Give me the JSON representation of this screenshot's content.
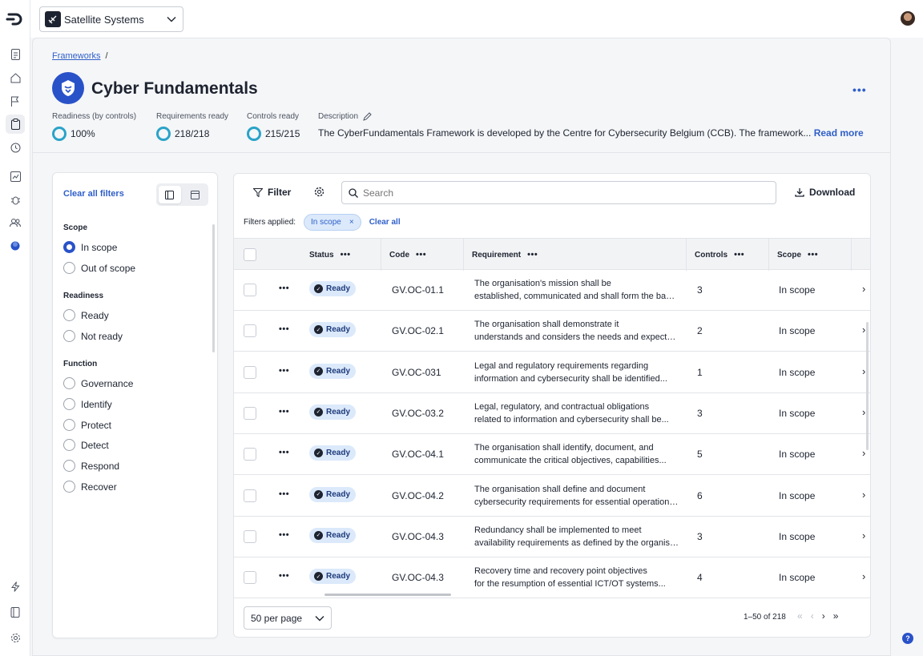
{
  "org": {
    "name": "Satellite Systems"
  },
  "breadcrumb": {
    "root": "Frameworks",
    "sep": "/"
  },
  "framework": {
    "title": "Cyber Fundamentals",
    "stats": [
      {
        "label": "Readiness (by controls)",
        "value": "100%"
      },
      {
        "label": "Requirements ready",
        "value": "218/218"
      },
      {
        "label": "Controls ready",
        "value": "215/215"
      }
    ],
    "description": {
      "label": "Description",
      "text": "The CyberFundamentals Framework is developed by the Centre for Cybersecurity Belgium (CCB). The framework...",
      "read_more": "Read more"
    }
  },
  "filters": {
    "clear_label": "Clear all filters",
    "sections": [
      {
        "title": "Scope",
        "options": [
          {
            "label": "In scope",
            "selected": true
          },
          {
            "label": "Out of scope",
            "selected": false
          }
        ]
      },
      {
        "title": "Readiness",
        "options": [
          {
            "label": "Ready",
            "selected": false
          },
          {
            "label": "Not ready",
            "selected": false
          }
        ]
      },
      {
        "title": "Function",
        "options": [
          {
            "label": "Governance",
            "selected": false
          },
          {
            "label": "Identify",
            "selected": false
          },
          {
            "label": "Protect",
            "selected": false
          },
          {
            "label": "Detect",
            "selected": false
          },
          {
            "label": "Respond",
            "selected": false
          },
          {
            "label": "Recover",
            "selected": false
          }
        ]
      }
    ]
  },
  "toolbar": {
    "filter_label": "Filter",
    "search_placeholder": "Search",
    "download_label": "Download",
    "applied_label": "Filters applied:",
    "chip_label": "In scope",
    "chip_close": "×",
    "clear_all": "Clear all"
  },
  "table": {
    "headers": {
      "status": "Status",
      "code": "Code",
      "requirement": "Requirement",
      "controls": "Controls",
      "scope": "Scope",
      "menu": "•••"
    },
    "rows": [
      {
        "status": "Ready",
        "code": "GV.OC-01.1",
        "req1": "The organisation's mission shall be",
        "req2": "established, communicated and shall form the basis for...",
        "controls": "3",
        "scope": "In scope"
      },
      {
        "status": "Ready",
        "code": "GV.OC-02.1",
        "req1": "The organisation shall demonstrate it",
        "req2": "understands and considers the needs and expectations...",
        "controls": "2",
        "scope": "In scope"
      },
      {
        "status": "Ready",
        "code": "GV.OC-031",
        "req1": "Legal and regulatory requirements regarding",
        "req2": "information and cybersecurity shall be identified...",
        "controls": "1",
        "scope": "In scope"
      },
      {
        "status": "Ready",
        "code": "GV.OC-03.2",
        "req1": "Legal, regulatory, and contractual obligations",
        "req2": "related to information and cybersecurity shall be...",
        "controls": "3",
        "scope": "In scope"
      },
      {
        "status": "Ready",
        "code": "GV.OC-04.1",
        "req1": "The organisation shall identify, document, and",
        "req2": "communicate the critical objectives, capabilities...",
        "controls": "5",
        "scope": "In scope"
      },
      {
        "status": "Ready",
        "code": "GV.OC-04.2",
        "req1": "The organisation shall define and document",
        "req2": "cybersecurity requirements for essential operations...",
        "controls": "6",
        "scope": "In scope"
      },
      {
        "status": "Ready",
        "code": "GV.OC-04.3",
        "req1": "Redundancy shall be implemented to meet",
        "req2": "availability requirements as defined by the organisation...",
        "controls": "3",
        "scope": "In scope"
      },
      {
        "status": "Ready",
        "code": "GV.OC-04.3",
        "req1": "Recovery time and recovery point objectives",
        "req2": "for the resumption of essential ICT/OT systems...",
        "controls": "4",
        "scope": "In scope"
      }
    ]
  },
  "pagination": {
    "per_page": "50 per page",
    "range": "1–50 of 218"
  },
  "icons": [
    "logo-icon",
    "document-icon",
    "home-icon",
    "flag-icon",
    "clipboard-icon",
    "history-icon",
    "chart-icon",
    "bug-icon",
    "users-icon",
    "globe-icon",
    "bolt-icon",
    "book-icon",
    "gear-icon",
    "chevron-down-icon",
    "search-icon",
    "download-icon",
    "filter-icon",
    "pencil-icon",
    "help-icon"
  ],
  "colors": {
    "accent": "#2952c9",
    "ring": "#2aa3c8",
    "chip_bg": "#dbe9fb"
  }
}
